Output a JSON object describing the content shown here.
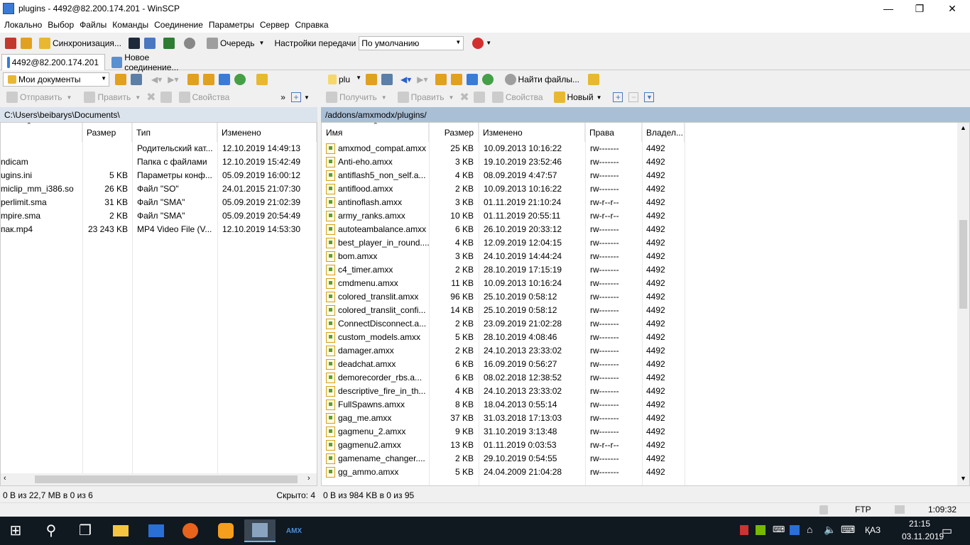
{
  "window": {
    "title": "plugins - 4492@82.200.174.201 - WinSCP",
    "minimize": "—",
    "maximize": "❐",
    "close": "✕"
  },
  "menu": [
    "Локально",
    "Выбор",
    "Файлы",
    "Команды",
    "Соединение",
    "Параметры",
    "Сервер",
    "Справка"
  ],
  "toolbar": {
    "sync_label": "Синхронизация...",
    "queue_label": "Очередь",
    "transfer_label": "Настройки передачи",
    "transfer_value": "По умолчанию"
  },
  "tabs": {
    "session": "4492@82.200.174.201",
    "new_session": "Новое соединение..."
  },
  "left": {
    "location": "Мои документы",
    "path": "C:\\Users\\beibarys\\Documents\\",
    "actions": {
      "send": "Отправить",
      "edit": "Править",
      "props": "Свойства"
    },
    "columns": {
      "size": "Размер",
      "type": "Тип",
      "modified": "Изменено"
    },
    "files": [
      {
        "name": "",
        "size": "",
        "type": "Родительский кат...",
        "modified": "12.10.2019  14:49:13"
      },
      {
        "name": "ndicam",
        "size": "",
        "type": "Папка с файлами",
        "modified": "12.10.2019  15:42:49"
      },
      {
        "name": "ugins.ini",
        "size": "5 KB",
        "type": "Параметры конф...",
        "modified": "05.09.2019  16:00:12"
      },
      {
        "name": "miclip_mm_i386.so",
        "size": "26 KB",
        "type": "Файл \"SO\"",
        "modified": "24.01.2015  21:07:30"
      },
      {
        "name": "perlimit.sma",
        "size": "31 KB",
        "type": "Файл \"SMA\"",
        "modified": "05.09.2019  21:02:39"
      },
      {
        "name": "mpire.sma",
        "size": "2 KB",
        "type": "Файл \"SMA\"",
        "modified": "05.09.2019  20:54:49"
      },
      {
        "name": "пак.mp4",
        "size": "23 243 KB",
        "type": "MP4 Video File (V...",
        "modified": "12.10.2019  14:53:30"
      }
    ],
    "status": "0 B из 22,7 MB в 0 из 6",
    "hidden": "Скрыто: 4"
  },
  "right": {
    "location": "plu",
    "path": "/addons/amxmodx/plugins/",
    "actions": {
      "get": "Получить",
      "edit": "Править",
      "props": "Свойства",
      "new": "Новый",
      "find": "Найти файлы..."
    },
    "columns": {
      "name": "Имя",
      "size": "Размер",
      "modified": "Изменено",
      "rights": "Права",
      "owner": "Владел..."
    },
    "files": [
      {
        "name": "amxmod_compat.amxx",
        "size": "25 KB",
        "modified": "10.09.2013 10:16:22",
        "rights": "rw-------",
        "owner": "4492"
      },
      {
        "name": "Anti-eho.amxx",
        "size": "3 KB",
        "modified": "19.10.2019 23:52:46",
        "rights": "rw-------",
        "owner": "4492"
      },
      {
        "name": "antiflash5_non_self.a...",
        "size": "4 KB",
        "modified": "08.09.2019 4:47:57",
        "rights": "rw-------",
        "owner": "4492"
      },
      {
        "name": "antiflood.amxx",
        "size": "2 KB",
        "modified": "10.09.2013 10:16:22",
        "rights": "rw-------",
        "owner": "4492"
      },
      {
        "name": "antinoflash.amxx",
        "size": "3 KB",
        "modified": "01.11.2019 21:10:24",
        "rights": "rw-r--r--",
        "owner": "4492"
      },
      {
        "name": "army_ranks.amxx",
        "size": "10 KB",
        "modified": "01.11.2019 20:55:11",
        "rights": "rw-r--r--",
        "owner": "4492"
      },
      {
        "name": "autoteambalance.amxx",
        "size": "6 KB",
        "modified": "26.10.2019 20:33:12",
        "rights": "rw-------",
        "owner": "4492"
      },
      {
        "name": "best_player_in_round....",
        "size": "4 KB",
        "modified": "12.09.2019 12:04:15",
        "rights": "rw-------",
        "owner": "4492"
      },
      {
        "name": "bom.amxx",
        "size": "3 KB",
        "modified": "24.10.2019 14:44:24",
        "rights": "rw-------",
        "owner": "4492"
      },
      {
        "name": "c4_timer.amxx",
        "size": "2 KB",
        "modified": "28.10.2019 17:15:19",
        "rights": "rw-------",
        "owner": "4492"
      },
      {
        "name": "cmdmenu.amxx",
        "size": "11 KB",
        "modified": "10.09.2013 10:16:24",
        "rights": "rw-------",
        "owner": "4492"
      },
      {
        "name": "colored_translit.amxx",
        "size": "96 KB",
        "modified": "25.10.2019 0:58:12",
        "rights": "rw-------",
        "owner": "4492"
      },
      {
        "name": "colored_translit_confi...",
        "size": "14 KB",
        "modified": "25.10.2019 0:58:12",
        "rights": "rw-------",
        "owner": "4492"
      },
      {
        "name": "ConnectDisconnect.a...",
        "size": "2 KB",
        "modified": "23.09.2019 21:02:28",
        "rights": "rw-------",
        "owner": "4492"
      },
      {
        "name": "custom_models.amxx",
        "size": "5 KB",
        "modified": "28.10.2019 4:08:46",
        "rights": "rw-------",
        "owner": "4492"
      },
      {
        "name": "damager.amxx",
        "size": "2 KB",
        "modified": "24.10.2013 23:33:02",
        "rights": "rw-------",
        "owner": "4492"
      },
      {
        "name": "deadchat.amxx",
        "size": "6 KB",
        "modified": "16.09.2019 0:56:27",
        "rights": "rw-------",
        "owner": "4492"
      },
      {
        "name": "demorecorder_rbs.a...",
        "size": "6 KB",
        "modified": "08.02.2018 12:38:52",
        "rights": "rw-------",
        "owner": "4492"
      },
      {
        "name": "descriptive_fire_in_th...",
        "size": "4 KB",
        "modified": "24.10.2013 23:33:02",
        "rights": "rw-------",
        "owner": "4492"
      },
      {
        "name": "FullSpawns.amxx",
        "size": "8 KB",
        "modified": "18.04.2013 0:55:14",
        "rights": "rw-------",
        "owner": "4492"
      },
      {
        "name": "gag_me.amxx",
        "size": "37 KB",
        "modified": "31.03.2018 17:13:03",
        "rights": "rw-------",
        "owner": "4492"
      },
      {
        "name": "gagmenu_2.amxx",
        "size": "9 KB",
        "modified": "31.10.2019 3:13:48",
        "rights": "rw-------",
        "owner": "4492"
      },
      {
        "name": "gagmenu2.amxx",
        "size": "13 KB",
        "modified": "01.11.2019 0:03:53",
        "rights": "rw-r--r--",
        "owner": "4492"
      },
      {
        "name": "gamename_changer....",
        "size": "2 KB",
        "modified": "29.10.2019 0:54:55",
        "rights": "rw-------",
        "owner": "4492"
      },
      {
        "name": "gg_ammo.amxx",
        "size": "5 KB",
        "modified": "24.04.2009 21:04:28",
        "rights": "rw-------",
        "owner": "4492"
      }
    ],
    "status": "0 B из 984 KB в 0 из 95"
  },
  "bottom": {
    "protocol": "FTP",
    "elapsed": "1:09:32"
  },
  "taskbar": {
    "lang": "ҚАЗ",
    "time": "21:15",
    "date": "03.11.2019"
  },
  "colors": {
    "path_right_bg": "#a9bfd6",
    "path_left_bg": "#dbe3ec",
    "taskbar": "#101820"
  }
}
